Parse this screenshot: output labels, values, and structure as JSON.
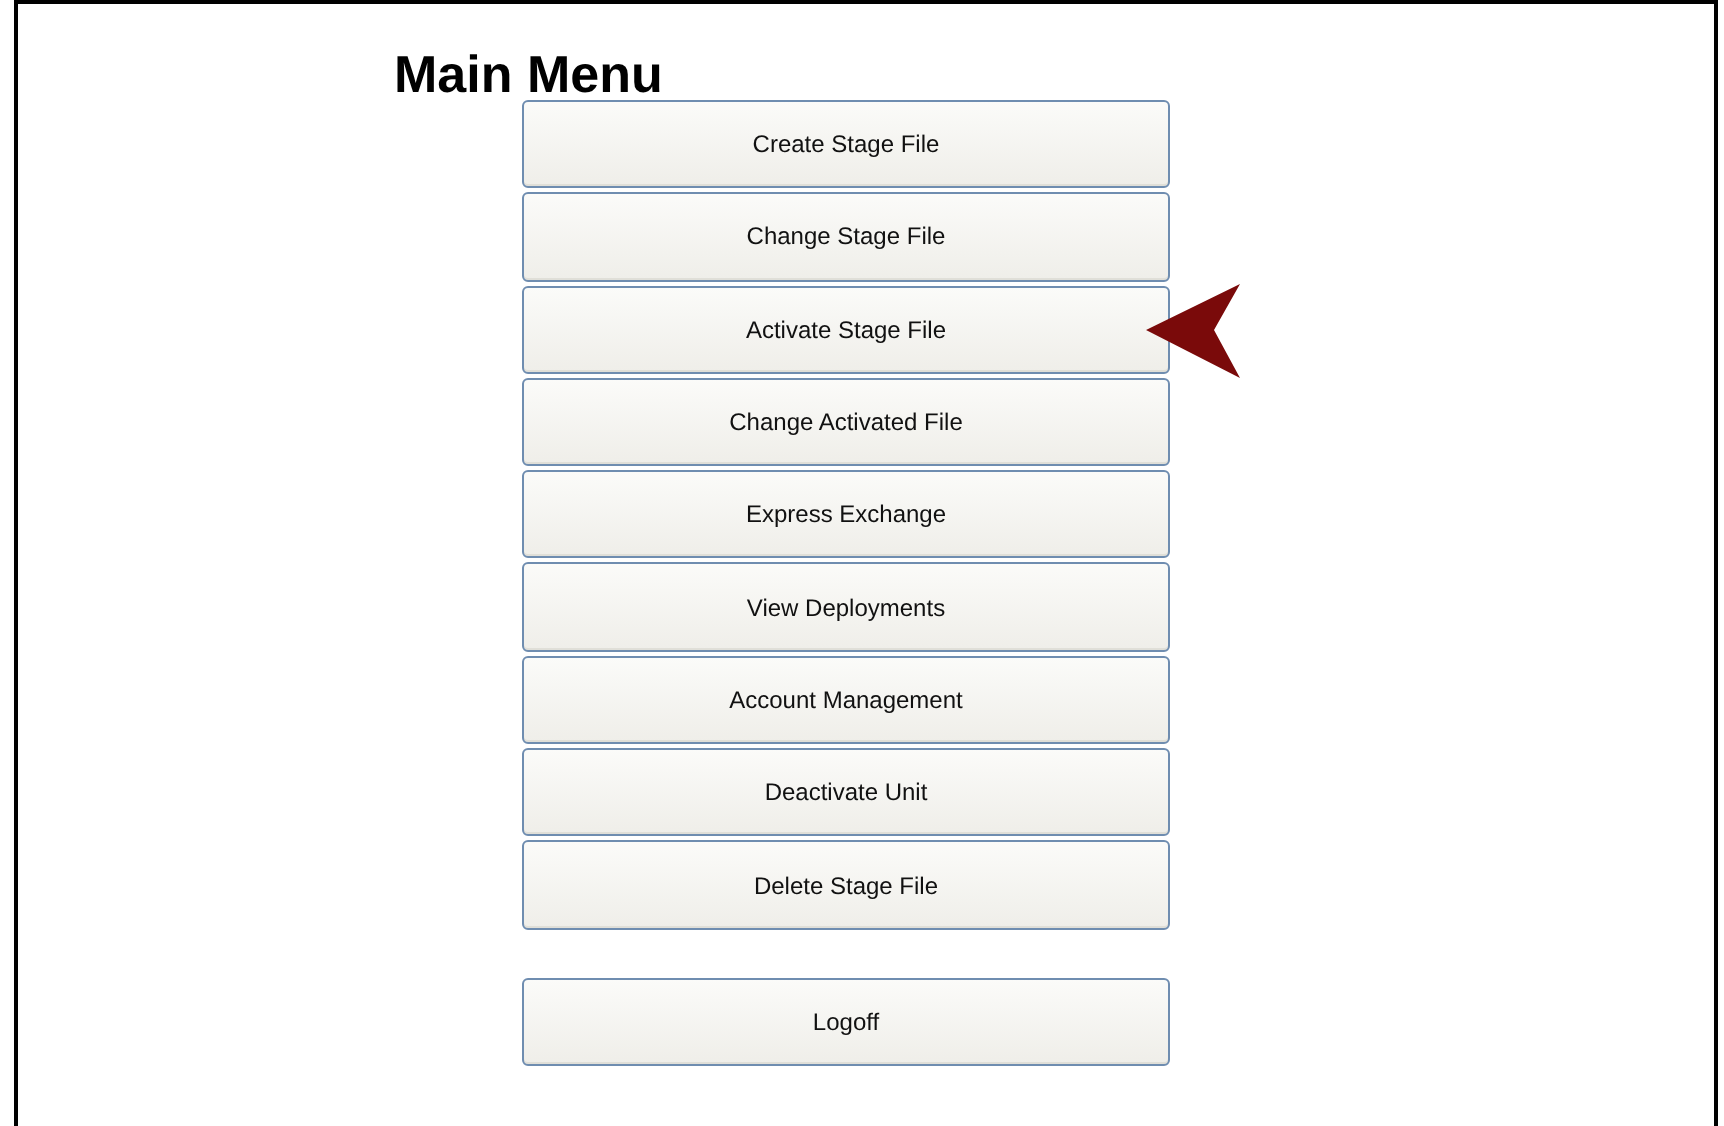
{
  "title": "Main Menu",
  "menu_items": [
    {
      "label": "Create Stage File",
      "pointed": false
    },
    {
      "label": "Change Stage File",
      "pointed": false
    },
    {
      "label": "Activate Stage File",
      "pointed": true
    },
    {
      "label": "Change Activated File",
      "pointed": false
    },
    {
      "label": "Express Exchange",
      "pointed": false
    },
    {
      "label": "View Deployments",
      "pointed": false
    },
    {
      "label": "Account Management",
      "pointed": false
    },
    {
      "label": "Deactivate Unit",
      "pointed": false
    },
    {
      "label": "Delete Stage File",
      "pointed": false
    }
  ],
  "logoff": {
    "label": "Logoff"
  }
}
